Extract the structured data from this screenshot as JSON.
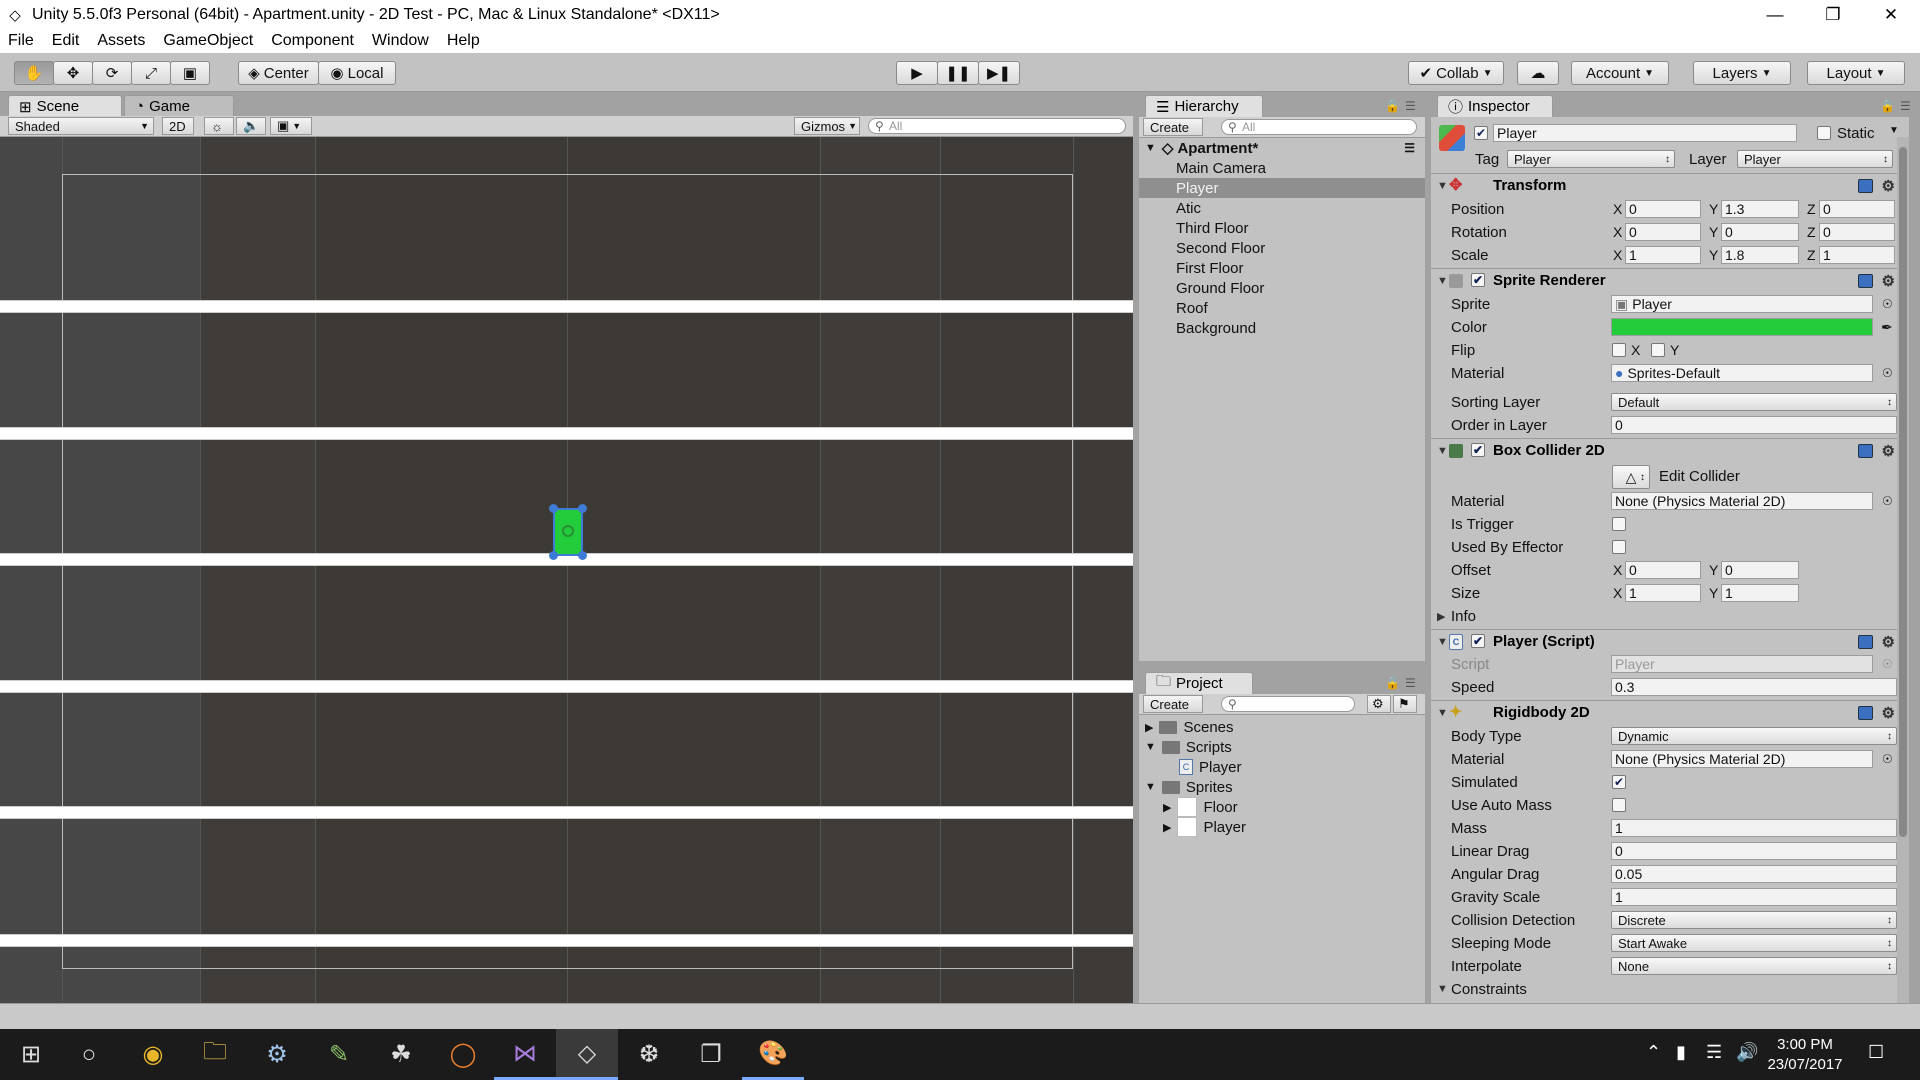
{
  "window": {
    "title": "Unity 5.5.0f3 Personal (64bit) - Apartment.unity - 2D Test - PC, Mac & Linux Standalone* <DX11>",
    "minimize": "—",
    "maximize": "❐",
    "close": "✕"
  },
  "menu": [
    "File",
    "Edit",
    "Assets",
    "GameObject",
    "Component",
    "Window",
    "Help"
  ],
  "toolbar": {
    "center_label": "Center",
    "local_label": "Local",
    "collab_label": "Collab",
    "account_label": "Account",
    "layers_label": "Layers",
    "layout_label": "Layout"
  },
  "scene_panel": {
    "tab_scene": "Scene",
    "tab_game": "Game",
    "shading_mode": "Shaded",
    "mode_2d": "2D",
    "gizmos_label": "Gizmos",
    "search_placeholder": "All"
  },
  "hierarchy": {
    "tab": "Hierarchy",
    "create_label": "Create",
    "search_placeholder": "All",
    "scene_name": "Apartment*",
    "items": [
      "Main Camera",
      "Player",
      "Atic",
      "Third Floor",
      "Second Floor",
      "First Floor",
      "Ground Floor",
      "Roof",
      "Background"
    ],
    "selected": "Player"
  },
  "project": {
    "tab": "Project",
    "create_label": "Create",
    "tree": [
      {
        "name": "Scenes",
        "type": "folder",
        "expanded": false
      },
      {
        "name": "Scripts",
        "type": "folder",
        "expanded": true
      },
      {
        "name": "Player",
        "type": "script"
      },
      {
        "name": "Sprites",
        "type": "folder",
        "expanded": true
      },
      {
        "name": "Floor",
        "type": "sprite"
      },
      {
        "name": "Player",
        "type": "sprite"
      }
    ]
  },
  "inspector": {
    "tab": "Inspector",
    "object_name": "Player",
    "static_label": "Static",
    "tag_label": "Tag",
    "tag_value": "Player",
    "layer_label": "Layer",
    "layer_value": "Player",
    "transform": {
      "title": "Transform",
      "position_label": "Position",
      "position": {
        "x": "0",
        "y": "1.3",
        "z": "0"
      },
      "rotation_label": "Rotation",
      "rotation": {
        "x": "0",
        "y": "0",
        "z": "0"
      },
      "scale_label": "Scale",
      "scale": {
        "x": "1",
        "y": "1.8",
        "z": "1"
      }
    },
    "sprite_renderer": {
      "title": "Sprite Renderer",
      "sprite_label": "Sprite",
      "sprite": "Player",
      "color_label": "Color",
      "color": "#22cc3a",
      "flip_label": "Flip",
      "flip_x": "X",
      "flip_y": "Y",
      "material_label": "Material",
      "material": "Sprites-Default",
      "sorting_layer_label": "Sorting Layer",
      "sorting_layer": "Default",
      "order_label": "Order in Layer",
      "order": "0"
    },
    "box_collider": {
      "title": "Box Collider 2D",
      "edit_label": "Edit Collider",
      "material_label": "Material",
      "material": "None (Physics Material 2D)",
      "is_trigger_label": "Is Trigger",
      "used_by_effector_label": "Used By Effector",
      "offset_label": "Offset",
      "offset": {
        "x": "0",
        "y": "0"
      },
      "size_label": "Size",
      "size": {
        "x": "1",
        "y": "1"
      },
      "info_label": "Info"
    },
    "player_script": {
      "title": "Player (Script)",
      "script_label": "Script",
      "script": "Player",
      "speed_label": "Speed",
      "speed": "0.3"
    },
    "rigidbody": {
      "title": "Rigidbody 2D",
      "body_type_label": "Body Type",
      "body_type": "Dynamic",
      "material_label": "Material",
      "material": "None (Physics Material 2D)",
      "simulated_label": "Simulated",
      "auto_mass_label": "Use Auto Mass",
      "mass_label": "Mass",
      "mass": "1",
      "linear_drag_label": "Linear Drag",
      "linear_drag": "0",
      "angular_drag_label": "Angular Drag",
      "angular_drag": "0.05",
      "gravity_label": "Gravity Scale",
      "gravity": "1",
      "collision_label": "Collision Detection",
      "collision": "Discrete",
      "sleeping_label": "Sleeping Mode",
      "sleeping": "Start Awake",
      "interpolate_label": "Interpolate",
      "interpolate": "None",
      "constraints_label": "Constraints"
    }
  },
  "taskbar": {
    "time": "3:00 PM",
    "date": "23/07/2017"
  },
  "colors": {
    "player_sprite": "#22cc3a",
    "selection": "#3e7bd6"
  }
}
